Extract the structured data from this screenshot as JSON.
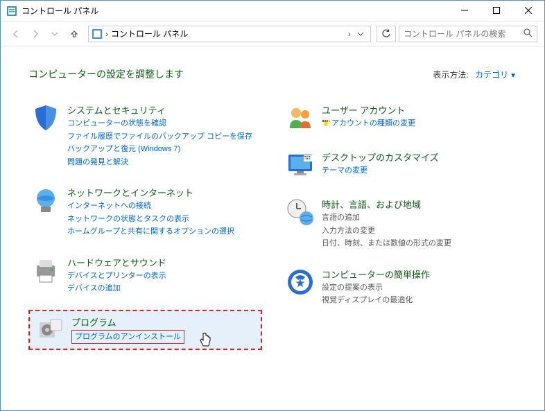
{
  "window": {
    "title": "コントロール パネル"
  },
  "nav": {
    "breadcrumb": "コントロール パネル",
    "search_placeholder": "コントロール パネルの検索"
  },
  "header": {
    "title": "コンピューターの設定を調整します",
    "view_label": "表示方法:",
    "view_value": "カテゴリ"
  },
  "left": [
    {
      "title": "システムとセキュリティ",
      "links": [
        "コンピューターの状態を確認",
        "ファイル履歴でファイルのバックアップ コピーを保存",
        "バックアップと復元 (Windows 7)",
        "問題の発見と解決"
      ]
    },
    {
      "title": "ネットワークとインターネット",
      "links": [
        "インターネットへの接続",
        "ネットワークの状態とタスクの表示",
        "ホームグループと共有に関するオプションの選択"
      ]
    },
    {
      "title": "ハードウェアとサウンド",
      "links": [
        "デバイスとプリンターの表示",
        "デバイスの追加"
      ]
    },
    {
      "title": "プログラム",
      "links": [
        "プログラムのアンインストール"
      ]
    }
  ],
  "right": [
    {
      "title": "ユーザー アカウント",
      "links": [
        "アカウントの種類の変更"
      ]
    },
    {
      "title": "デスクトップのカスタマイズ",
      "links": [
        "テーマの変更"
      ]
    },
    {
      "title": "時計、言語、および地域",
      "subs": [
        "言語の追加",
        "入力方法の変更",
        "日付、時刻、または数値の形式の変更"
      ]
    },
    {
      "title": "コンピューターの簡単操作",
      "subs": [
        "設定の提案の表示",
        "視覚ディスプレイの最適化"
      ]
    }
  ]
}
